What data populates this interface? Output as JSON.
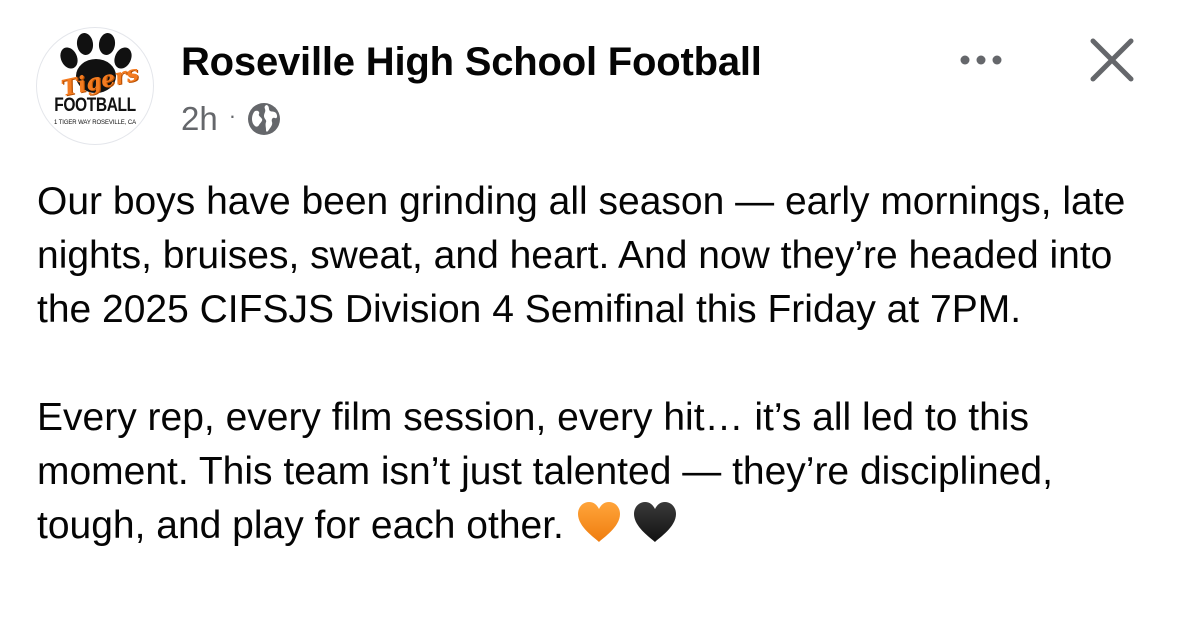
{
  "post": {
    "page_name": "Roseville High School Football",
    "time": "2h",
    "separator": "·",
    "audience_icon": "globe-icon",
    "avatar": {
      "logo_script": "Tigers",
      "logo_word": "FOOTBALL",
      "logo_address": "1 TIGER WAY ROSEVILLE, CA"
    },
    "paragraphs": [
      "Our boys have been grinding all season — early mornings, late nights, bruises, sweat, and heart. And now they’re headed into the 2025 CIFSJS Division 4 Semifinal this Friday at 7PM.",
      "Every rep, every film session, every hit… it’s all led to this moment. This team isn’t just talented — they’re disciplined, tough, and play for each other. "
    ],
    "emojis": [
      "orange-heart-icon",
      "black-heart-icon"
    ]
  },
  "header_actions": {
    "more_icon": "more-dots-icon",
    "close_icon": "close-icon"
  },
  "colors": {
    "text_primary": "#050505",
    "text_secondary": "#65676b",
    "brand_orange": "#f47b20",
    "heart_orange": "#f7931e",
    "heart_black": "#1c1c1c"
  }
}
